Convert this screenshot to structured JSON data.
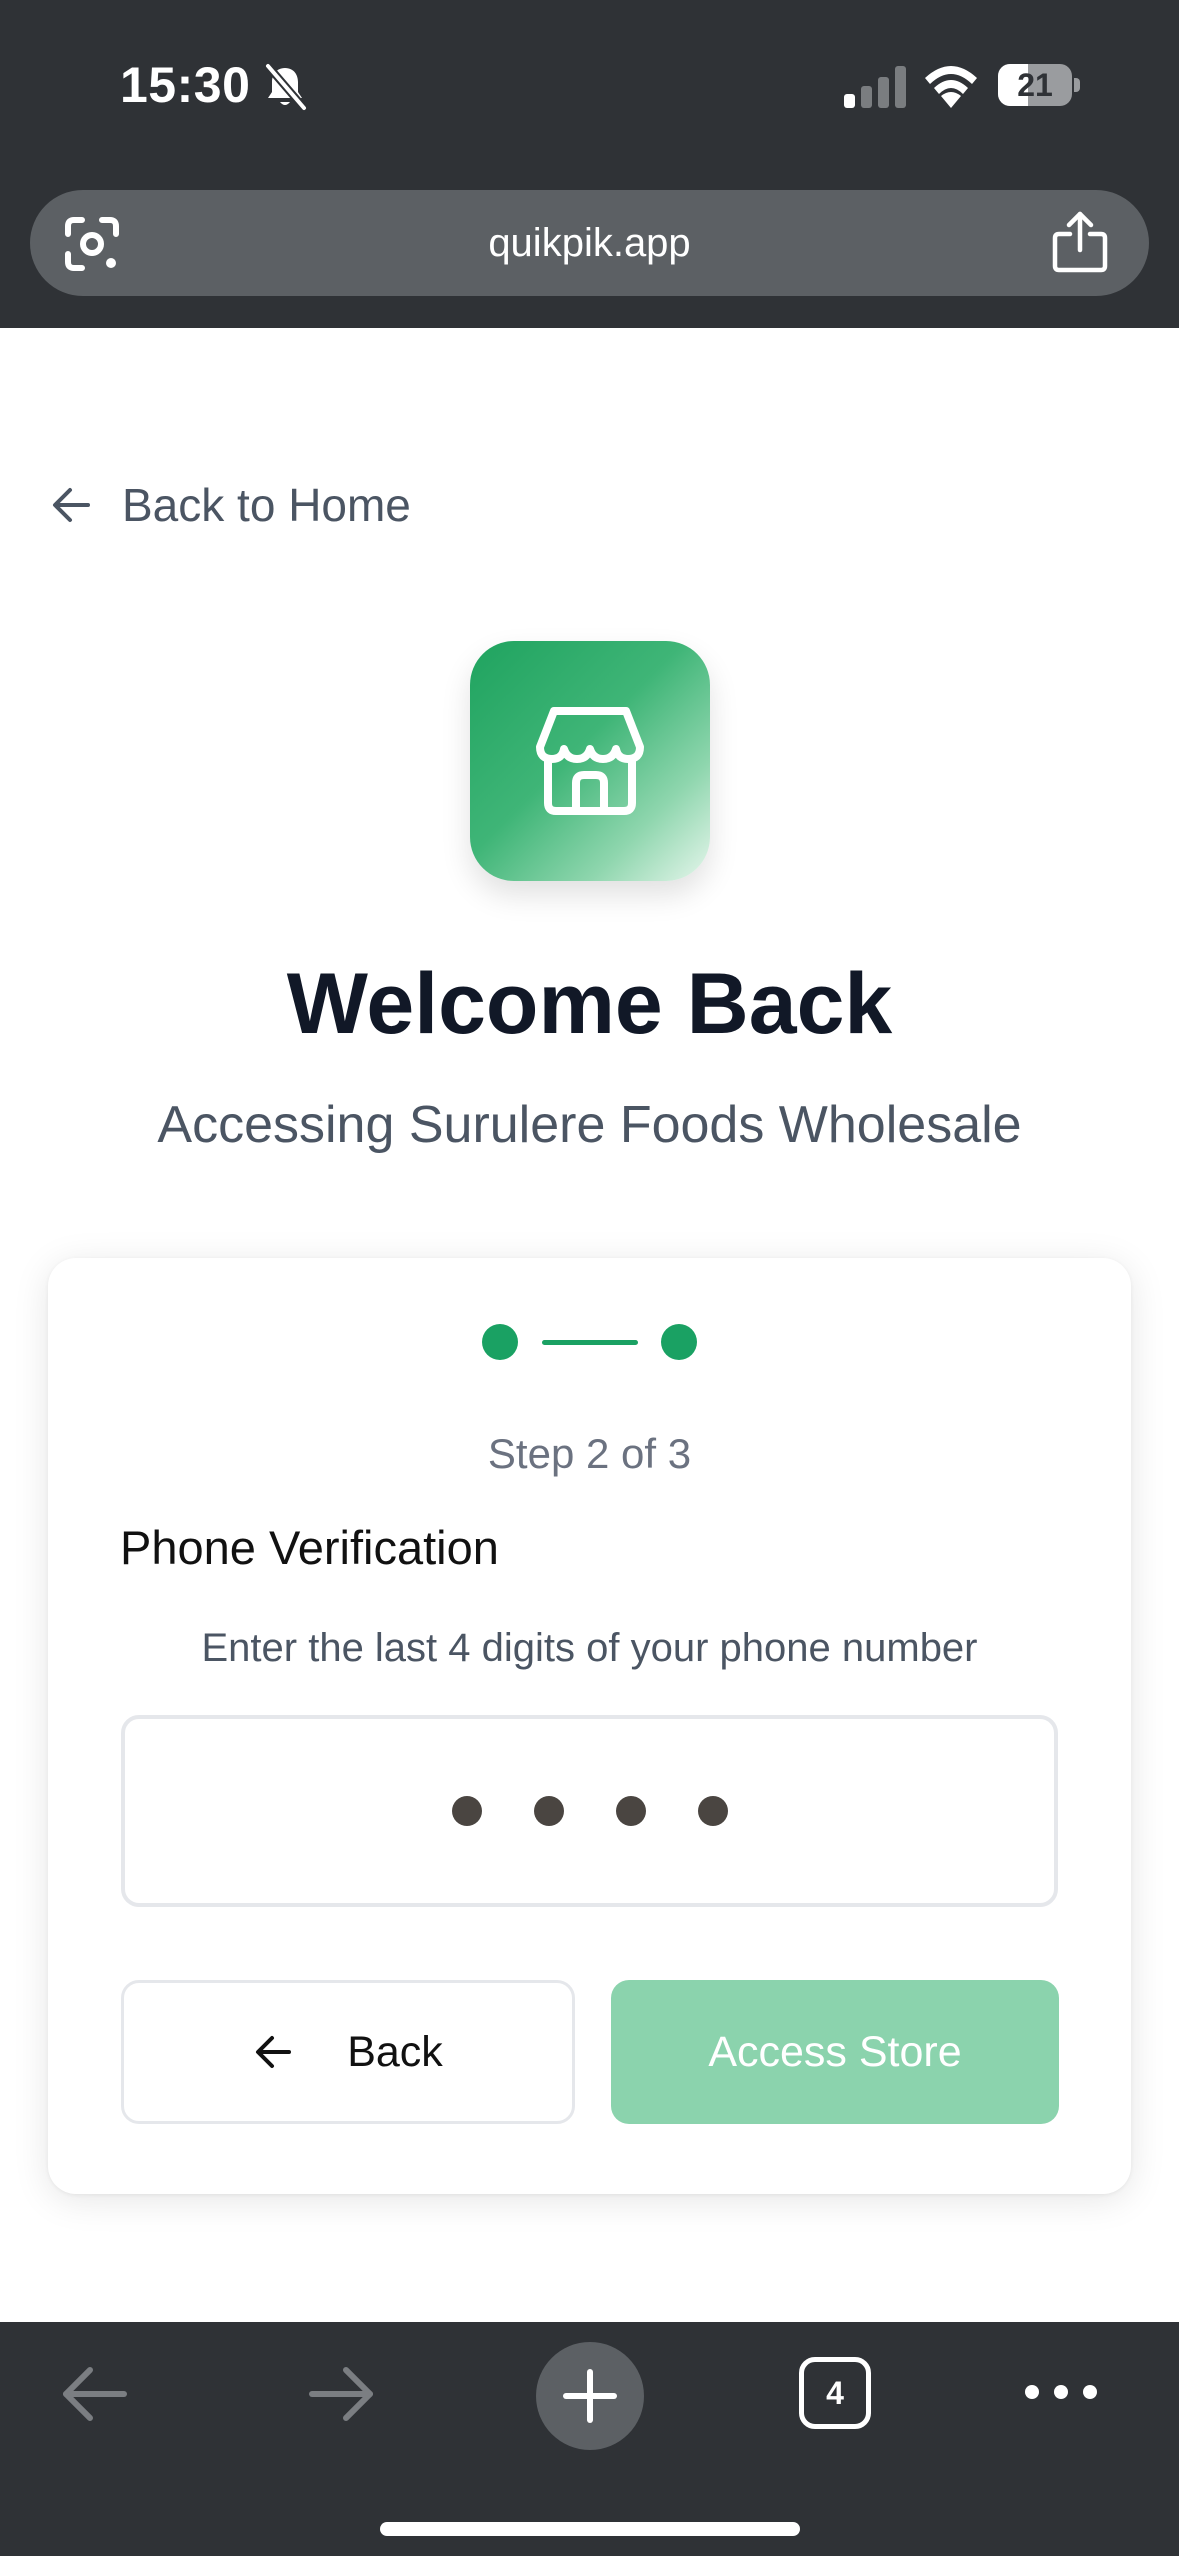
{
  "status_bar": {
    "time": "15:30",
    "battery_level": "21",
    "icons": [
      "bell-slash-icon",
      "cellular-signal-icon",
      "wifi-icon",
      "battery-icon"
    ]
  },
  "browser": {
    "url": "quikpik.app",
    "tab_count": "4",
    "icons": [
      "lens-icon",
      "share-icon",
      "back-arrow-icon",
      "forward-arrow-icon",
      "plus-icon",
      "tabs-icon",
      "more-icon"
    ]
  },
  "page": {
    "back_link": "Back to Home",
    "title": "Welcome Back",
    "subtitle": "Accessing Surulere Foods Wholesale",
    "store_icon": "storefront-icon"
  },
  "verification": {
    "step_label": "Step 2 of 3",
    "section_title": "Phone Verification",
    "instruction": "Enter the last 4 digits of your phone number",
    "pin_length": 4,
    "back_button": "Back",
    "access_button": "Access Store"
  },
  "colors": {
    "chrome_bg": "#2f3236",
    "accent_green": "#1aa163",
    "access_button_disabled": "#8bd3ad",
    "title_text": "#111827",
    "muted_text": "#4b5563"
  }
}
